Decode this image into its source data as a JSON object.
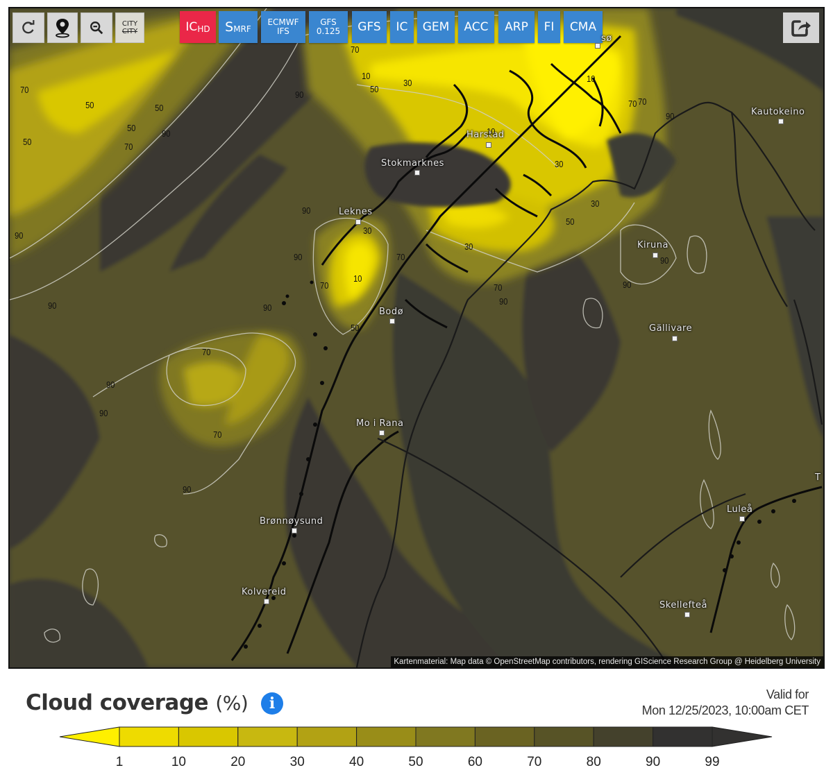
{
  "toolbar": {
    "left_tools": [
      {
        "name": "refresh",
        "icon": "refresh-icon"
      },
      {
        "name": "location",
        "icon": "map-pin-icon"
      },
      {
        "name": "zoom-out",
        "icon": "zoom-out-icon"
      },
      {
        "name": "city-labels",
        "icon": "city-toggle-icon",
        "line1": "CITY",
        "line2": "CITY"
      }
    ],
    "models": [
      {
        "main": "IC",
        "sub": "HD",
        "active": true
      },
      {
        "main": "S",
        "sub": "MRF",
        "active": false
      },
      {
        "line1": "ECMWF",
        "line2": "IFS",
        "active": false
      },
      {
        "line1": "GFS",
        "line2": "0.125",
        "active": false
      },
      {
        "label": "GFS",
        "active": false
      },
      {
        "label": "IC",
        "active": false
      },
      {
        "label": "GEM",
        "active": false
      },
      {
        "label": "ACC",
        "active": false
      },
      {
        "label": "ARP",
        "active": false
      },
      {
        "label": "FI",
        "active": false
      },
      {
        "label": "CMA",
        "active": false
      }
    ],
    "share_icon": "share-icon"
  },
  "map": {
    "cities": [
      {
        "name": "Harstad"
      },
      {
        "name": "Stokmarknes"
      },
      {
        "name": "Leknes"
      },
      {
        "name": "Bodø"
      },
      {
        "name": "Mo i Rana"
      },
      {
        "name": "Brønnøysund"
      },
      {
        "name": "Kolvereid"
      },
      {
        "name": "Kautokeino"
      },
      {
        "name": "Kiruna"
      },
      {
        "name": "Gällivare"
      },
      {
        "name": "Luleå"
      },
      {
        "name": "Skellefteå"
      },
      {
        "name": "sø"
      },
      {
        "name": "T"
      }
    ],
    "contour_labels": [
      "70",
      "10",
      "50",
      "30",
      "70",
      "50",
      "50",
      "50",
      "90",
      "70",
      "50",
      "70",
      "90",
      "90",
      "10",
      "70",
      "90",
      "30",
      "10",
      "30",
      "50",
      "30",
      "30",
      "70",
      "90",
      "70",
      "90",
      "90",
      "50",
      "90",
      "90",
      "90",
      "70",
      "90",
      "90",
      "90",
      "90",
      "70",
      "70",
      "10"
    ],
    "attribution": "Kartenmaterial: Map data © OpenStreetMap contributors, rendering GIScience Research Group @ Heidelberg University"
  },
  "legend": {
    "title": "Cloud coverage",
    "unit": "(%)",
    "info_icon": "info-icon",
    "valid_for_label": "Valid for",
    "valid_for_time": "Mon 12/25/2023, 10:00am CET",
    "ticks": [
      "1",
      "10",
      "20",
      "30",
      "40",
      "50",
      "60",
      "70",
      "80",
      "90",
      "99"
    ],
    "colors": [
      "#fff000",
      "#eedb00",
      "#d9c700",
      "#c8b810",
      "#b2a214",
      "#998d18",
      "#807820",
      "#6a6322",
      "#575326",
      "#44412c",
      "#323130"
    ]
  }
}
